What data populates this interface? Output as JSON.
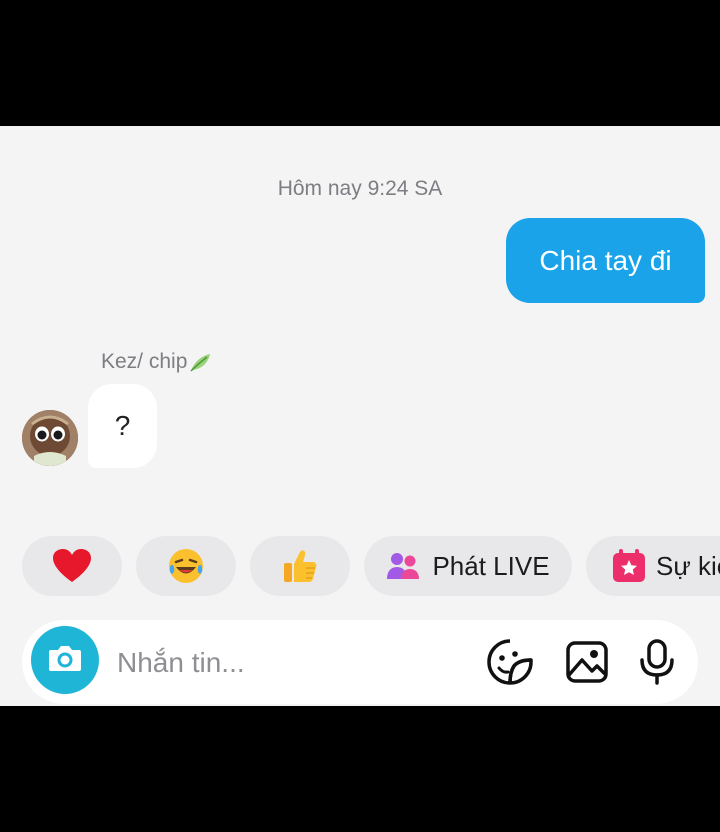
{
  "conversation": {
    "timestamp": "Hôm nay 9:24 SA",
    "outgoing_message": "Chia tay đi",
    "sender_name": "Kez/ chip",
    "incoming_message": "?"
  },
  "quick_actions": {
    "heart": "heart-emoji",
    "laugh": "laughing-crying-emoji",
    "thumbs": "thumbs-up-emoji",
    "live_label": "Phát LIVE",
    "event_label": "Sự kiê"
  },
  "composer": {
    "placeholder": "Nhắn tin..."
  },
  "colors": {
    "accent": "#1aa3e8",
    "camera": "#1fb5d6",
    "background": "#f4f4f5"
  }
}
